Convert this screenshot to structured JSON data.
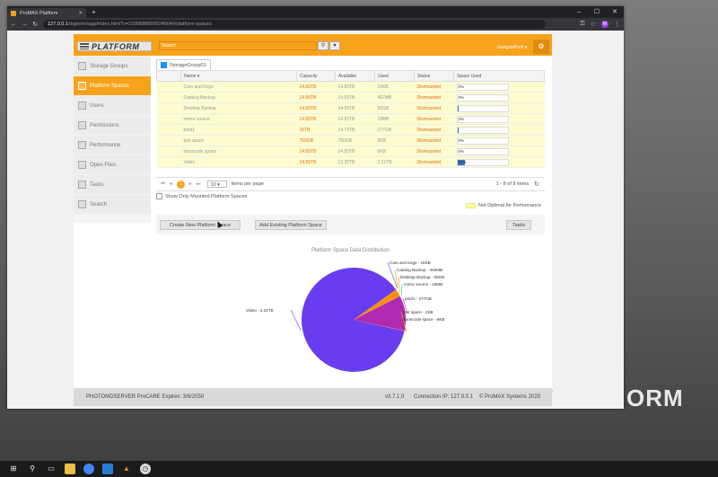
{
  "browser": {
    "tab_title": "ProMAX Platform",
    "url_host": "127.0.0.1",
    "url_path": "/login/en/app/index.html?v=1590688000024604#/platform-spaces",
    "avatar_initial": "M"
  },
  "header": {
    "logo_text": "PLATFORM",
    "search_placeholder": "Search",
    "user_name": "GangstaProfi"
  },
  "sidebar": {
    "items": [
      {
        "label": "Storage Groups",
        "icon": "storage-icon",
        "active": false
      },
      {
        "label": "Platform Spaces",
        "icon": "platform-space-icon",
        "active": true
      },
      {
        "label": "Users",
        "icon": "users-icon",
        "active": false
      },
      {
        "label": "Permissions",
        "icon": "permissions-icon",
        "active": false
      },
      {
        "label": "Performance",
        "icon": "performance-icon",
        "active": false
      },
      {
        "label": "Open Files",
        "icon": "open-files-icon",
        "active": false
      },
      {
        "label": "Tasks",
        "icon": "tasks-icon",
        "active": false
      },
      {
        "label": "Search",
        "icon": "search-icon",
        "active": false
      }
    ]
  },
  "storage_tab": "StorageGroup01",
  "table": {
    "columns": [
      "Name",
      "Capacity",
      "Available",
      "Used",
      "Status",
      "Space Used"
    ],
    "rows": [
      {
        "name": "Cars and Kegs",
        "capacity": "14.60TB",
        "available": "14.60TB",
        "used": "16KB",
        "status": "Dismounted",
        "pct": "0%",
        "fill": 0
      },
      {
        "name": "Catalog Backup",
        "capacity": "14.55TB",
        "available": "14.55TB",
        "used": "452MB",
        "status": "Dismounted",
        "pct": "0%",
        "fill": 0
      },
      {
        "name": "Desktop Backup",
        "capacity": "14.60TB",
        "available": "14.56TB",
        "used": "56GB",
        "status": "Dismounted",
        "pct": "",
        "fill": 1
      },
      {
        "name": "mirror source",
        "capacity": "14.55TB",
        "available": "14.55TB",
        "used": "18MB",
        "status": "Dismounted",
        "pct": "0%",
        "fill": 0
      },
      {
        "name": "pmd1",
        "capacity": "15TB",
        "available": "14.73TB",
        "used": "277GB",
        "status": "Dismounted",
        "pct": "",
        "fill": 1
      },
      {
        "name": "test space",
        "capacity": "750GB",
        "available": "750GB",
        "used": "2KB",
        "status": "Dismounted",
        "pct": "0%",
        "fill": 0
      },
      {
        "name": "transcode space",
        "capacity": "14.55TB",
        "available": "14.55TB",
        "used": "6KB",
        "status": "Dismounted",
        "pct": "0%",
        "fill": 0
      },
      {
        "name": "Video",
        "capacity": "14.55TB",
        "available": "12.35TB",
        "used": "2.21TB",
        "status": "Dismounted",
        "pct": "15%",
        "fill": 15
      }
    ]
  },
  "pager": {
    "current": "1",
    "page_size": "10",
    "per_page_label": "items per page",
    "info": "1 - 8 of 8 items"
  },
  "show_only_mounted": "Show Only Mounted Platform Spaces",
  "not_optimal_label": "Not Optimal for Performance",
  "buttons": {
    "create": "Create New Platform Space",
    "add": "Add Existing Platform Space",
    "tasks": "Tasks"
  },
  "chart_data": {
    "type": "pie",
    "title": "Platform Space Data Distribution",
    "slices": [
      {
        "name": "Cars and Kegs",
        "label": "Cars and Kegs - 16KB",
        "value_gb": 1.6e-05,
        "color": "#3366cc"
      },
      {
        "name": "Catalog Backup",
        "label": "Catalog Backup - 452MB",
        "value_gb": 0.452,
        "color": "#dc9a15"
      },
      {
        "name": "Desktop Backup",
        "label": "Desktop Backup - 56GB",
        "value_gb": 56,
        "color": "#ff8c00"
      },
      {
        "name": "mirror source",
        "label": "mirror source - 18MB",
        "value_gb": 0.018,
        "color": "#20b2aa"
      },
      {
        "name": "pmd1",
        "label": "pmd1 - 277GB",
        "value_gb": 277,
        "color": "#b02bb0"
      },
      {
        "name": "test space",
        "label": "test space - 2KB",
        "value_gb": 2e-06,
        "color": "#e0c020"
      },
      {
        "name": "transcode space",
        "label": "transcode space - 6KB",
        "value_gb": 6e-06,
        "color": "#dd2222"
      },
      {
        "name": "Video",
        "label": "Video - 2.21TB",
        "value_gb": 2210,
        "color": "#6a3cf0"
      }
    ]
  },
  "footer": {
    "license": "PHOTOMDSERVER ProCARE Expires: 3/6/2050",
    "version": "v3.7.1.0",
    "connection": "Connection IP: 127.0.0.1",
    "copyright": "© ProMAX Systems 2020"
  },
  "desktop_brand": "ORM"
}
